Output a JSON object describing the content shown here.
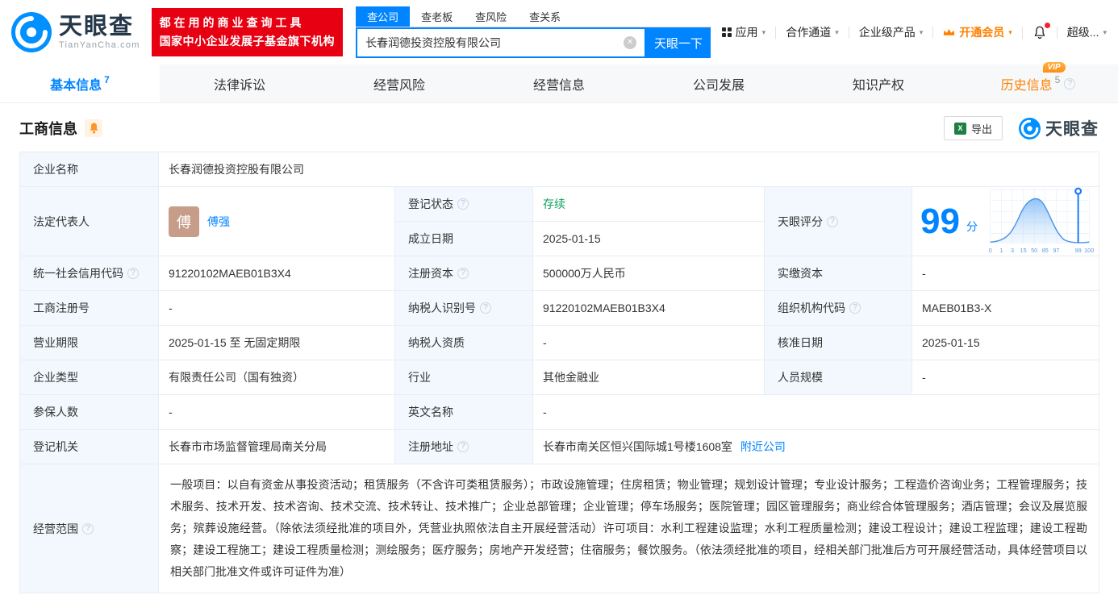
{
  "header": {
    "logo": {
      "brand": "天眼查",
      "domain": "TianYanCha.com"
    },
    "slogan_line1": "都在用的商业查询工具",
    "slogan_line2": "国家中小企业发展子基金旗下机构",
    "search": {
      "tabs": [
        {
          "label": "查公司",
          "active": true
        },
        {
          "label": "查老板",
          "active": false
        },
        {
          "label": "查风险",
          "active": false
        },
        {
          "label": "查关系",
          "active": false
        }
      ],
      "value": "长春润德投资控股有限公司",
      "button_label": "天眼一下"
    },
    "menu": {
      "apps": "应用",
      "partners": "合作通道",
      "enterprise": "企业级产品",
      "vip": "开通会员",
      "super": "超级..."
    }
  },
  "nav_tabs": [
    {
      "label": "基本信息",
      "count": "7"
    },
    {
      "label": "法律诉讼"
    },
    {
      "label": "经营风险"
    },
    {
      "label": "经营信息"
    },
    {
      "label": "公司发展"
    },
    {
      "label": "知识产权"
    },
    {
      "label": "历史信息",
      "count": "5",
      "badge": "VIP"
    }
  ],
  "toolbar": {
    "section_title": "工商信息",
    "export_label": "导出",
    "brand": "天眼查"
  },
  "info": {
    "company_name_label": "企业名称",
    "company_name": "长春润德投资控股有限公司",
    "legal_rep_label": "法定代表人",
    "legal_rep_avatar": "傅",
    "legal_rep_name": "傅强",
    "reg_status_label": "登记状态",
    "reg_status": "存续",
    "establish_date_label": "成立日期",
    "establish_date": "2025-01-15",
    "score_label": "天眼评分",
    "score_value": "99",
    "score_unit": "分",
    "credit_code_label": "统一社会信用代码",
    "credit_code": "91220102MAEB01B3X4",
    "reg_capital_label": "注册资本",
    "reg_capital": "500000万人民币",
    "paid_capital_label": "实缴资本",
    "paid_capital": "-",
    "reg_number_label": "工商注册号",
    "reg_number": "-",
    "taxpayer_id_label": "纳税人识别号",
    "taxpayer_id": "91220102MAEB01B3X4",
    "org_code_label": "组织机构代码",
    "org_code": "MAEB01B3-X",
    "business_term_label": "营业期限",
    "business_term": "2025-01-15 至 无固定期限",
    "taxpayer_quality_label": "纳税人资质",
    "taxpayer_quality": "-",
    "approval_date_label": "核准日期",
    "approval_date": "2025-01-15",
    "company_type_label": "企业类型",
    "company_type": "有限责任公司（国有独资）",
    "industry_label": "行业",
    "industry": "其他金融业",
    "staff_size_label": "人员规模",
    "staff_size": "-",
    "insured_count_label": "参保人数",
    "insured_count": "-",
    "english_name_label": "英文名称",
    "english_name": "-",
    "reg_authority_label": "登记机关",
    "reg_authority": "长春市市场监督管理局南关分局",
    "reg_address_label": "注册地址",
    "reg_address": "长春市南关区恒兴国际城1号楼1608室",
    "nearby_link": "附近公司",
    "business_scope_label": "经营范围",
    "business_scope": "一般项目：以自有资金从事投资活动；租赁服务（不含许可类租赁服务）；市政设施管理；住房租赁；物业管理；规划设计管理；专业设计服务；工程造价咨询业务；工程管理服务；技术服务、技术开发、技术咨询、技术交流、技术转让、技术推广；企业总部管理；企业管理；停车场服务；医院管理；园区管理服务；商业综合体管理服务；酒店管理；会议及展览服务；殡葬设施经营。（除依法须经批准的项目外，凭营业执照依法自主开展经营活动）许可项目：水利工程建设监理；水利工程质量检测；建设工程设计；建设工程监理；建设工程勘察；建设工程施工；建设工程质量检测；测绘服务；医疗服务；房地产开发经营；住宿服务；餐饮服务。（依法须经批准的项目，经相关部门批准后方可开展经营活动，具体经营项目以相关部门批准文件或许可证件为准）"
  },
  "score_chart": {
    "type": "area",
    "curve": "score-distribution-bell",
    "x_labels": [
      "0",
      "1",
      "3",
      "15",
      "50",
      "85",
      "97",
      "99",
      "100"
    ],
    "marker_value": "99",
    "accent_color": "#0084ff"
  }
}
